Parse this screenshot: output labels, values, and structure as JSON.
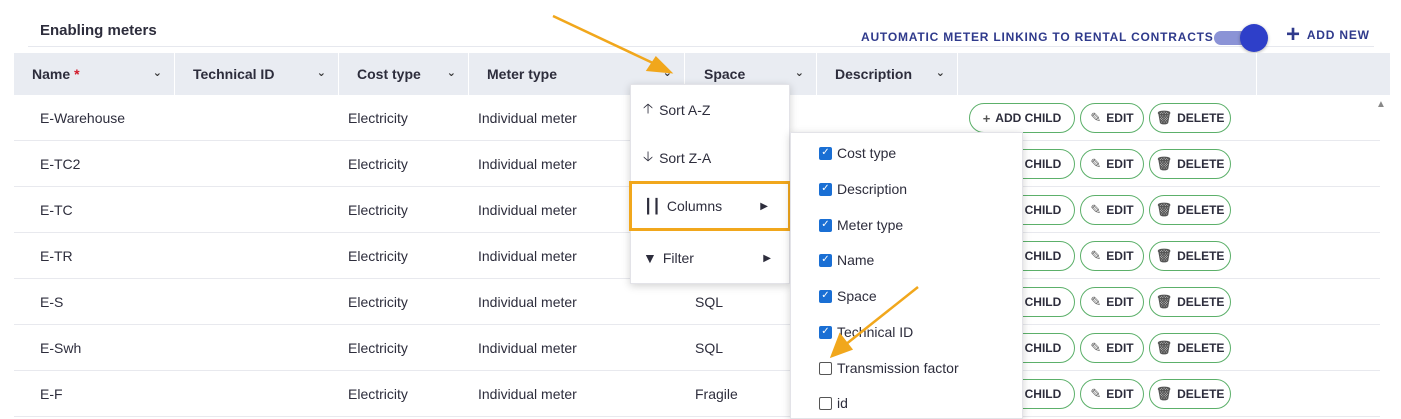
{
  "section_title": "Enabling meters",
  "toggle": {
    "label": "AUTOMATIC METER LINKING TO RENTAL CONTRACTS",
    "on": true
  },
  "add_new_label": "ADD NEW",
  "columns": [
    {
      "label": "Name",
      "required_mark": "*"
    },
    {
      "label": "Technical ID"
    },
    {
      "label": "Cost type"
    },
    {
      "label": "Meter type"
    },
    {
      "label": "Space"
    },
    {
      "label": "Description"
    }
  ],
  "rows": [
    {
      "name": "E-Warehouse",
      "cost": "Electricity",
      "mtype": "Individual meter",
      "space": ""
    },
    {
      "name": "E-TC2",
      "cost": "Electricity",
      "mtype": "Individual meter",
      "space": ""
    },
    {
      "name": "E-TC",
      "cost": "Electricity",
      "mtype": "Individual meter",
      "space": ""
    },
    {
      "name": "E-TR",
      "cost": "Electricity",
      "mtype": "Individual meter",
      "space": ""
    },
    {
      "name": "E-S",
      "cost": "Electricity",
      "mtype": "Individual meter",
      "space": "SQL"
    },
    {
      "name": "E-Swh",
      "cost": "Electricity",
      "mtype": "Individual meter",
      "space": "SQL"
    },
    {
      "name": "E-F",
      "cost": "Electricity",
      "mtype": "Individual meter",
      "space": "Fragile"
    }
  ],
  "row_actions": {
    "add_child": "ADD CHILD",
    "add_child_partial": "CHILD",
    "edit": "EDIT",
    "delete": "DELETE"
  },
  "column_menu": {
    "sort_asc": "Sort A-Z",
    "sort_desc": "Sort Z-A",
    "columns": "Columns",
    "filter": "Filter"
  },
  "columns_submenu": [
    {
      "label": "Cost type",
      "checked": true
    },
    {
      "label": "Description",
      "checked": true
    },
    {
      "label": "Meter type",
      "checked": true
    },
    {
      "label": "Name",
      "checked": true
    },
    {
      "label": "Space",
      "checked": true
    },
    {
      "label": "Technical ID",
      "checked": true
    },
    {
      "label": "Transmission factor",
      "checked": false
    },
    {
      "label": "id",
      "checked": false
    }
  ],
  "colors": {
    "accent": "#2f3a8c",
    "toggle": "#2e3fc9",
    "button_border": "#5cb06a",
    "highlight": "#f1a71c",
    "checkbox": "#1a6fd4",
    "required": "#d11a2a"
  }
}
